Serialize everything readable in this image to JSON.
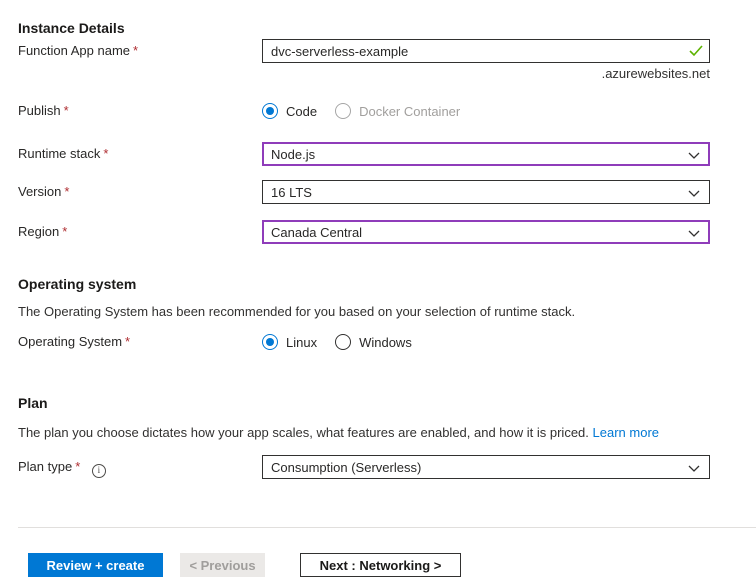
{
  "colors": {
    "primary_blue": "#0078d4",
    "dirty_field_border": "#8f3cba",
    "success_green": "#5db300",
    "link_blue": "#0078d4",
    "required_red": "#ae2c30"
  },
  "required_marker": "*",
  "icons": {
    "info_glyph": "i"
  },
  "instance_details": {
    "title": "Instance Details",
    "function_app_name": {
      "label": "Function App name",
      "value": "dvc-serverless-example",
      "suffix": ".azurewebsites.net"
    },
    "publish": {
      "label": "Publish",
      "option_code": "Code",
      "option_docker": "Docker Container"
    },
    "runtime_stack": {
      "label": "Runtime stack",
      "value": "Node.js"
    },
    "version": {
      "label": "Version",
      "value": "16 LTS"
    },
    "region": {
      "label": "Region",
      "value": "Canada Central"
    }
  },
  "operating_system": {
    "title": "Operating system",
    "description": "The Operating System has been recommended for you based on your selection of runtime stack.",
    "field_label": "Operating System",
    "option_linux": "Linux",
    "option_windows": "Windows"
  },
  "plan": {
    "title": "Plan",
    "description": "The plan you choose dictates how your app scales, what features are enabled, and how it is priced.",
    "learn_more": "Learn more",
    "plan_type": {
      "label": "Plan type",
      "value": "Consumption (Serverless)"
    }
  },
  "footer": {
    "review_create": "Review + create",
    "previous": "< Previous",
    "next": "Next : Networking >"
  }
}
